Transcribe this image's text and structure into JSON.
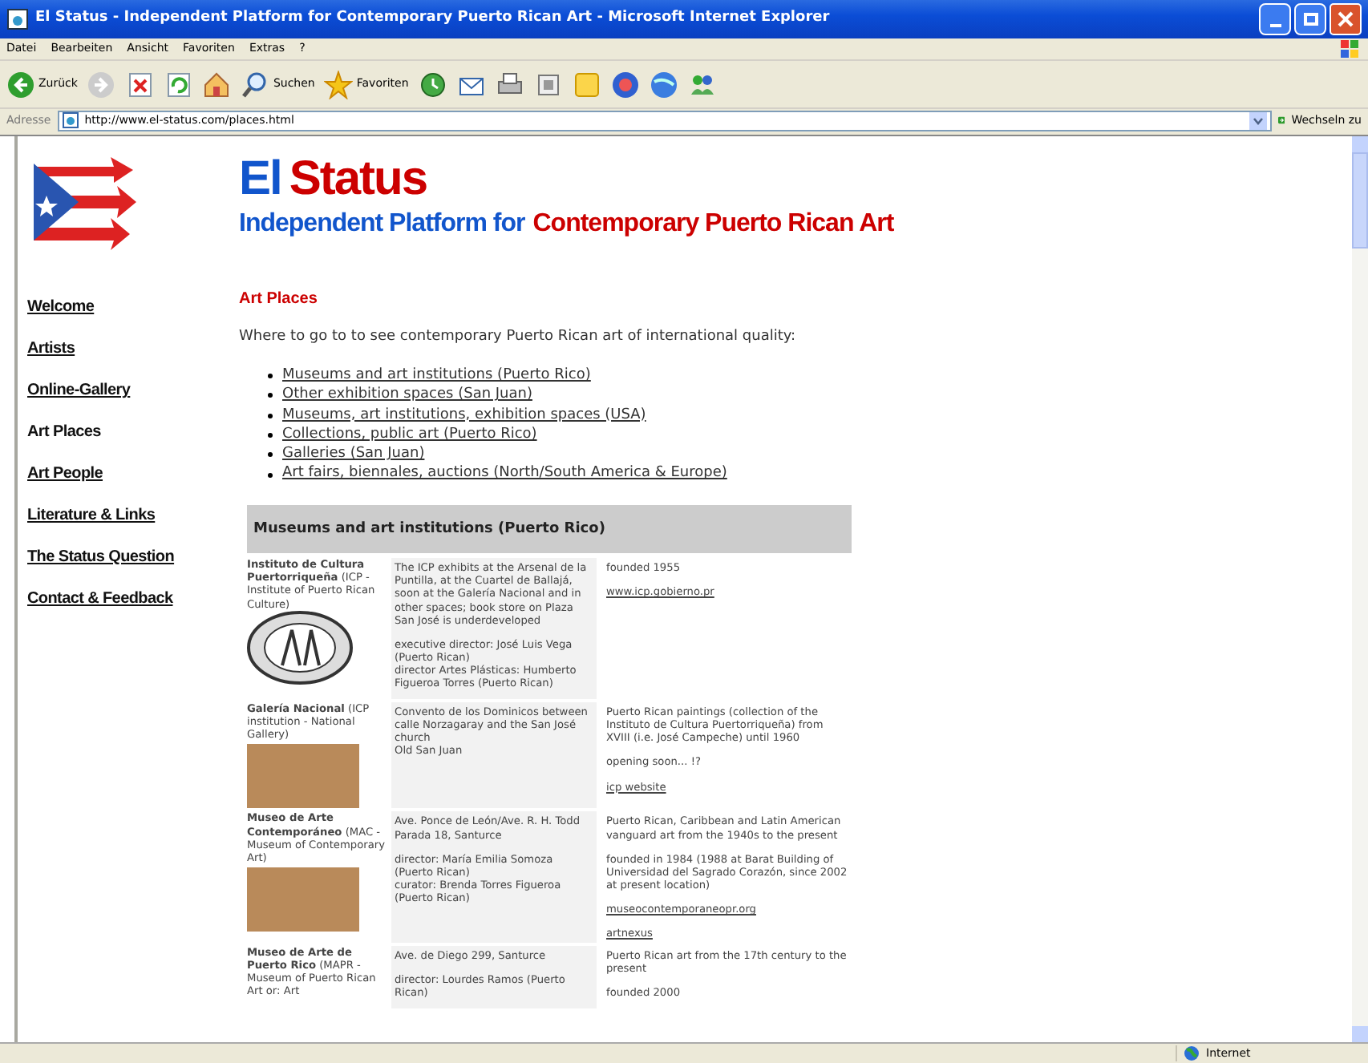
{
  "window": {
    "title": "El Status - Independent Platform for Contemporary Puerto Rican Art - Microsoft Internet Explorer"
  },
  "menu": [
    "Datei",
    "Bearbeiten",
    "Ansicht",
    "Favoriten",
    "Extras",
    "?"
  ],
  "toolbar": [
    {
      "kind": "back",
      "label": "Zurück"
    },
    {
      "kind": "forward"
    },
    {
      "kind": "stop"
    },
    {
      "kind": "refresh"
    },
    {
      "kind": "home"
    },
    {
      "kind": "search",
      "label": "Suchen"
    },
    {
      "kind": "favorites",
      "label": "Favoriten"
    },
    {
      "kind": "history"
    },
    {
      "kind": "mail"
    },
    {
      "kind": "print"
    },
    {
      "kind": "edit"
    },
    {
      "kind": "note"
    },
    {
      "kind": "messenger"
    },
    {
      "kind": "globe"
    },
    {
      "kind": "people"
    }
  ],
  "address_bar": {
    "label": "Adresse",
    "url": "http://www.el-status.com/places.html",
    "go": "Wechseln zu"
  },
  "site": {
    "title": [
      {
        "text": "El",
        "color": "#1155cc"
      },
      {
        "text": "Status",
        "color": "#cc0000"
      }
    ],
    "subtitle": [
      {
        "text": "Independent Platform for",
        "color": "#1155cc"
      },
      {
        "text": "Contemporary Puerto Rican Art",
        "color": "#cc0000"
      }
    ],
    "nav": [
      {
        "label": "Welcome",
        "selected": false
      },
      {
        "label": "Artists",
        "selected": false
      },
      {
        "label": "Online-Gallery",
        "selected": false
      },
      {
        "label": "Art Places",
        "selected": true
      },
      {
        "label": "Art People",
        "selected": false
      },
      {
        "label": "Literature & Links",
        "selected": false
      },
      {
        "label": "The Status Question",
        "selected": false
      },
      {
        "label": "Contact & Feedback",
        "selected": false
      }
    ],
    "heading": "Art Places",
    "intro": "Where to go to to see contemporary Puerto Rican art of international quality:",
    "links": [
      "Museums and art institutions (Puerto Rico)",
      "Other exhibition spaces (San Juan)",
      "Museums, art institutions, exhibition spaces (USA)",
      "Collections, public art (Puerto Rico)",
      "Galleries (San Juan)",
      "Art fairs, biennales, auctions (North/South America & Europe)"
    ],
    "table": {
      "title": "Museums and art institutions (Puerto Rico)",
      "rows": [
        {
          "name": "**Instituto de Cultura Puertorriqueña** (ICP - Institute of Puerto Rican Culture)",
          "kind": "seal",
          "location": [
            "The ICP exhibits at the Arsenal de la Puntilla, at the Cuartel de Ballajá, soon at the Galería Nacional and in other spaces; book store on Plaza San José is underdeveloped",
            "executive director: José Luis Vega (Puerto Rican)\ndirector Artes Plásticas: Humberto Figueroa Torres (Puerto Rican)"
          ],
          "info": [
            {
              "kind": "text",
              "text": "founded 1955"
            },
            {
              "kind": "link",
              "text": "www.icp.gobierno.pr"
            }
          ]
        },
        {
          "name": "**Galería Nacional** (ICP institution - National Gallery)",
          "kind": "photo",
          "location": [
            "Convento de los Dominicos between calle Norzagaray and the San José church\nOld San Juan"
          ],
          "info": [
            {
              "kind": "text",
              "text": "Puerto Rican paintings (collection of the Instituto de Cultura Puertorriqueña) from XVIII (i.e. José Campeche) until 1960"
            },
            {
              "kind": "text",
              "text": "opening soon... !?"
            },
            {
              "kind": "link",
              "text": "icp website"
            }
          ]
        },
        {
          "name": "**Museo de Arte Contemporáneo** (MAC - Museum of Contemporary Art)",
          "kind": "photo",
          "location": [
            "Ave. Ponce de León/Ave. R. H. Todd\nParada 18, Santurce",
            "director: María Emilia Somoza (Puerto Rican)\ncurator: Brenda Torres Figueroa (Puerto Rican)"
          ],
          "info": [
            {
              "kind": "text",
              "text": "Puerto Rican, Caribbean and Latin American vanguard art from the 1940s to the present"
            },
            {
              "kind": "text",
              "text": "founded in 1984 (1988 at Barat Building of Universidad del Sagrado Corazón, since 2002 at present location)"
            },
            {
              "kind": "link",
              "text": "museocontemporaneopr.org"
            },
            {
              "kind": "link",
              "text": "artnexus"
            }
          ]
        },
        {
          "name": "**Museo de Arte de Puerto Rico** (MAPR - Museum of Puerto Rican Art or: Art",
          "kind": "text",
          "location": [
            "Ave. de Diego 299, Santurce",
            "director: Lourdes Ramos (Puerto Rican)"
          ],
          "info": [
            {
              "kind": "text",
              "text": "Puerto Rican art from the 17th century to the present"
            },
            {
              "kind": "text",
              "text": "founded 2000"
            }
          ]
        }
      ]
    }
  },
  "status_bar": {
    "zone": "Internet"
  }
}
